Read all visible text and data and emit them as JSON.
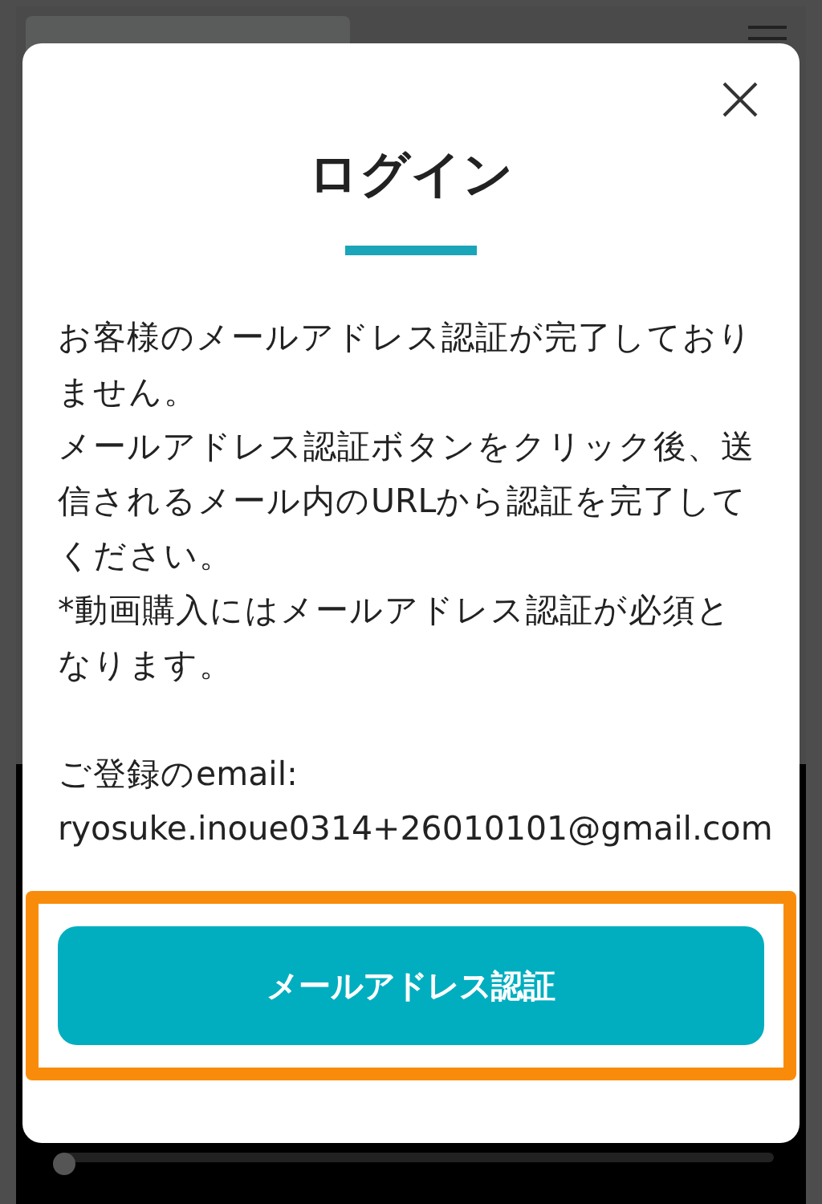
{
  "dialog": {
    "title": "ログイン",
    "paragraphs": [
      "お客様のメールアドレス認証が完了しておりません。",
      "メールアドレス認証ボタンをクリック後、送信されるメール内のURLから認証を完了してください。",
      "*動画購入にはメールアドレス認証が必須となります。"
    ],
    "email_label": "ご登録のemail:",
    "email": "ryosuke.inoue0314+26010101@gmail.com",
    "button": "メールアドレス認証"
  },
  "seek_bar": {
    "level": 0
  }
}
